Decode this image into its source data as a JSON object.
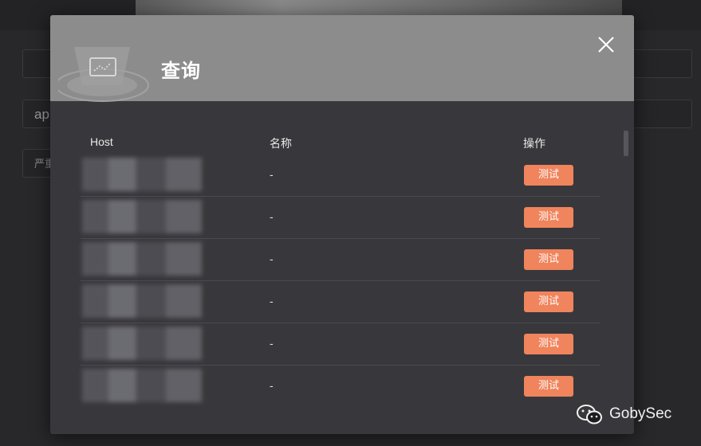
{
  "background": {
    "field_2_value": "ap",
    "field_3_value": "严重"
  },
  "modal": {
    "title": "查询",
    "close_icon": "close-icon",
    "header_icon": "chart-monitor-icon",
    "table": {
      "columns": {
        "host": "Host",
        "name": "名称",
        "operation": "操作"
      },
      "rows": [
        {
          "host": "",
          "name": "-",
          "action_label": "测试"
        },
        {
          "host": "",
          "name": "-",
          "action_label": "测试"
        },
        {
          "host": "",
          "name": "-",
          "action_label": "测试"
        },
        {
          "host": "",
          "name": "-",
          "action_label": "测试"
        },
        {
          "host": "",
          "name": "-",
          "action_label": "测试"
        },
        {
          "host": "",
          "name": "-",
          "action_label": "测试"
        }
      ]
    }
  },
  "watermark": {
    "text": "GobySec",
    "icon": "wechat-icon"
  },
  "colors": {
    "accent": "#f0845c",
    "header": "#8c8c8c",
    "modal_bg": "#38383c"
  }
}
